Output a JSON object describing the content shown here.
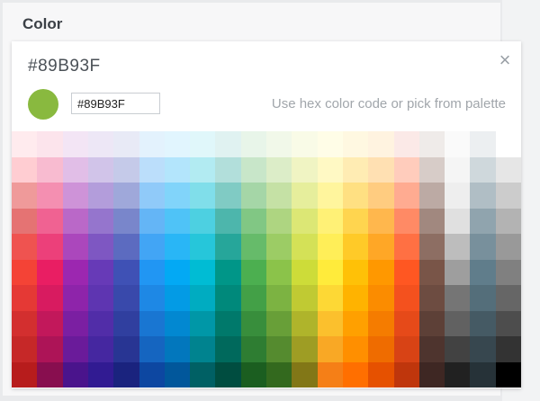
{
  "section": {
    "label": "Color"
  },
  "picker": {
    "current_hex": "#89B93F",
    "input_value": "#89B93F",
    "hint": "Use hex color code or pick from palette",
    "close_glyph": "×",
    "close_icon": "close-icon"
  },
  "palette": {
    "columns": 20,
    "rows": [
      [
        "#ffebee",
        "#fce4ec",
        "#f3e5f5",
        "#ede7f6",
        "#e8eaf6",
        "#e3f2fd",
        "#e1f5fe",
        "#e0f7fa",
        "#e0f2f1",
        "#e8f5e9",
        "#f1f8e9",
        "#f9fbe7",
        "#fffde7",
        "#fff8e1",
        "#fff3e0",
        "#fbe9e7",
        "#efebe9",
        "#fafafa",
        "#eceff1",
        "#ffffff"
      ],
      [
        "#ffcdd2",
        "#f8bbd0",
        "#e1bee7",
        "#d1c4e9",
        "#c5cae9",
        "#bbdefb",
        "#b3e5fc",
        "#b2ebf2",
        "#b2dfdb",
        "#c8e6c9",
        "#dcedc8",
        "#f0f4c3",
        "#fff9c4",
        "#ffecb3",
        "#ffe0b2",
        "#ffccbc",
        "#d7ccc8",
        "#f5f5f5",
        "#cfd8dc",
        "#e6e6e6"
      ],
      [
        "#ef9a9a",
        "#f48fb1",
        "#ce93d8",
        "#b39ddb",
        "#9fa8da",
        "#90caf9",
        "#81d4fa",
        "#80deea",
        "#80cbc4",
        "#a5d6a7",
        "#c5e1a5",
        "#e6ee9c",
        "#fff59d",
        "#ffe082",
        "#ffcc80",
        "#ffab91",
        "#bcaaa4",
        "#eeeeee",
        "#b0bec5",
        "#cccccc"
      ],
      [
        "#e57373",
        "#f06292",
        "#ba68c8",
        "#9575cd",
        "#7986cb",
        "#64b5f6",
        "#4fc3f7",
        "#4dd0e1",
        "#4db6ac",
        "#81c784",
        "#aed581",
        "#dce775",
        "#fff176",
        "#ffd54f",
        "#ffb74d",
        "#ff8a65",
        "#a1887f",
        "#e0e0e0",
        "#90a4ae",
        "#b3b3b3"
      ],
      [
        "#ef5350",
        "#ec407a",
        "#ab47bc",
        "#7e57c2",
        "#5c6bc0",
        "#42a5f5",
        "#29b6f6",
        "#26c6da",
        "#26a69a",
        "#66bb6a",
        "#9ccc65",
        "#d4e157",
        "#ffee58",
        "#ffca28",
        "#ffa726",
        "#ff7043",
        "#8d6e63",
        "#bdbdbd",
        "#78909c",
        "#999999"
      ],
      [
        "#f44336",
        "#e91e63",
        "#9c27b0",
        "#673ab7",
        "#3f51b5",
        "#2196f3",
        "#03a9f4",
        "#00bcd4",
        "#009688",
        "#4caf50",
        "#8bc34a",
        "#cddc39",
        "#ffeb3b",
        "#ffc107",
        "#ff9800",
        "#ff5722",
        "#795548",
        "#9e9e9e",
        "#607d8b",
        "#808080"
      ],
      [
        "#e53935",
        "#d81b60",
        "#8e24aa",
        "#5e35b1",
        "#3949ab",
        "#1e88e5",
        "#039be5",
        "#00acc1",
        "#00897b",
        "#43a047",
        "#7cb342",
        "#c0ca33",
        "#fdd835",
        "#ffb300",
        "#fb8c00",
        "#f4511e",
        "#6d4c41",
        "#757575",
        "#546e7a",
        "#666666"
      ],
      [
        "#d32f2f",
        "#c2185b",
        "#7b1fa2",
        "#512da8",
        "#303f9f",
        "#1976d2",
        "#0288d1",
        "#0097a7",
        "#00796b",
        "#388e3c",
        "#689f38",
        "#afb42b",
        "#fbc02d",
        "#ffa000",
        "#f57c00",
        "#e64a19",
        "#5d4037",
        "#616161",
        "#455a64",
        "#4d4d4d"
      ],
      [
        "#c62828",
        "#ad1457",
        "#6a1b9a",
        "#4527a0",
        "#283593",
        "#1565c0",
        "#0277bd",
        "#00838f",
        "#00695c",
        "#2e7d32",
        "#558b2f",
        "#9e9d24",
        "#f9a825",
        "#ff8f00",
        "#ef6c00",
        "#d84315",
        "#4e342e",
        "#424242",
        "#37474f",
        "#333333"
      ],
      [
        "#b71c1c",
        "#880e4f",
        "#4a148c",
        "#311b92",
        "#1a237e",
        "#0d47a1",
        "#01579b",
        "#006064",
        "#004d40",
        "#1b5e20",
        "#33691e",
        "#827717",
        "#f57f17",
        "#ff6f00",
        "#e65100",
        "#bf360c",
        "#3e2723",
        "#212121",
        "#263238",
        "#000000"
      ]
    ]
  }
}
